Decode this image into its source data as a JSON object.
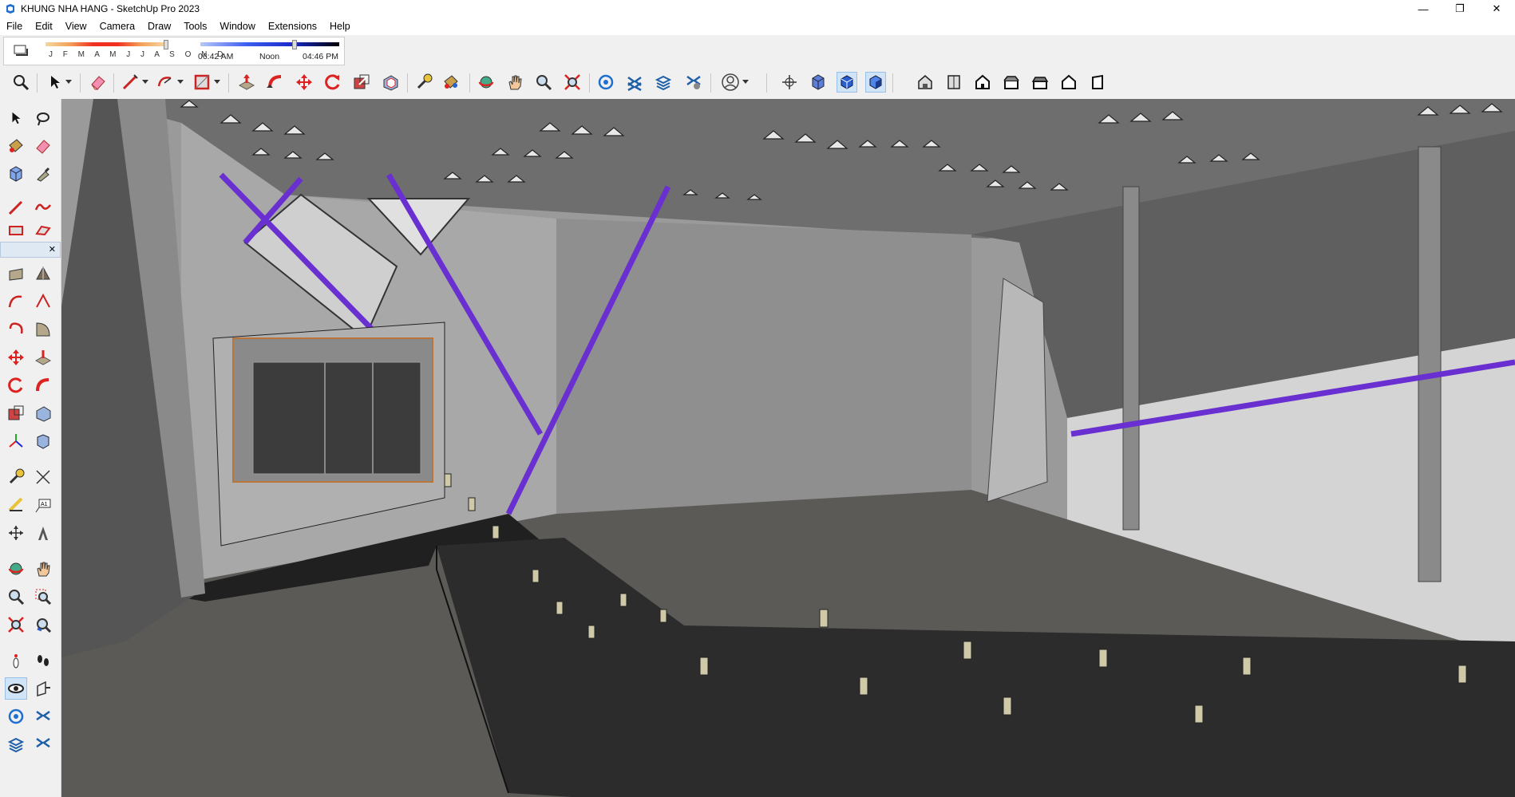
{
  "window": {
    "title": "KHUNG NHA HANG - SketchUp Pro 2023",
    "controls": {
      "minimize": "—",
      "maximize": "❐",
      "close": "✕"
    }
  },
  "menu": [
    "File",
    "Edit",
    "View",
    "Camera",
    "Draw",
    "Tools",
    "Window",
    "Extensions",
    "Help"
  ],
  "shadows": {
    "months": "J F M A M J J A S O N D",
    "time_start": "06:42 AM",
    "time_mid": "Noon",
    "time_end": "04:46 PM"
  },
  "toolbar_icons": [
    "search-icon",
    "select-icon",
    "eraser-icon",
    "line-icon",
    "arc-icon",
    "shape-icon",
    "push-pull-icon",
    "follow-me-icon",
    "move-icon",
    "rotate-icon",
    "scale-icon",
    "offset-icon",
    "tape-measure-icon",
    "paint-bucket-icon",
    "orbit-icon",
    "pan-icon",
    "zoom-icon",
    "zoom-extents-icon",
    "warehouse-icon",
    "extension-warehouse-icon",
    "layout-icon",
    "extension-manager-icon",
    "account-icon",
    "position-camera-icon",
    "component-icon",
    "style-icon",
    "shadow-icon",
    "iso-view-icon",
    "top-view-icon",
    "front-view-icon",
    "right-view-icon",
    "back-view-icon",
    "left-view-icon"
  ],
  "colors": {
    "purple_beam": "#6a2fd0",
    "floor": "#5c5a57",
    "ceiling": "#6e6e6e",
    "wall": "#9a9a9a",
    "deck": "#2c2c2c",
    "active_blue": "#cfe4f7"
  }
}
